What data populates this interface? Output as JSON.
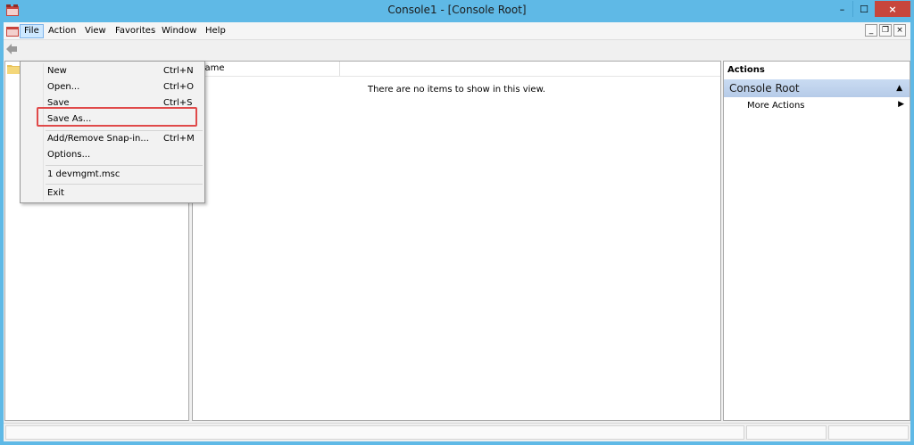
{
  "window": {
    "title": "Console1 - [Console Root]",
    "close_glyph": "×",
    "min_glyph": "–",
    "max_glyph": "☐"
  },
  "menubar": {
    "items": [
      {
        "label": "File"
      },
      {
        "label": "Action"
      },
      {
        "label": "View"
      },
      {
        "label": "Favorites"
      },
      {
        "label": "Window"
      },
      {
        "label": "Help"
      }
    ],
    "mdi_min": "_",
    "mdi_restore": "❐",
    "mdi_close": "×"
  },
  "file_menu": {
    "items": [
      {
        "label": "New",
        "shortcut": "Ctrl+N"
      },
      {
        "label": "Open...",
        "shortcut": "Ctrl+O"
      },
      {
        "label": "Save",
        "shortcut": "Ctrl+S"
      },
      {
        "label": "Save As...",
        "shortcut": ""
      },
      {
        "label": "Add/Remove Snap-in...",
        "shortcut": "Ctrl+M"
      },
      {
        "label": "Options...",
        "shortcut": ""
      },
      {
        "label": "1 devmgmt.msc",
        "shortcut": ""
      },
      {
        "label": "Exit",
        "shortcut": ""
      }
    ]
  },
  "list": {
    "column_name": "Name",
    "empty_message": "There are no items to show in this view."
  },
  "actions": {
    "title": "Actions",
    "section": "Console Root",
    "collapse_glyph": "▲",
    "more_actions": "More Actions",
    "more_arrow": "▶"
  },
  "colors": {
    "titlebar": "#5fb9e6",
    "close_button": "#c7463c",
    "highlight_border": "#e04a4a",
    "actions_header": "#c9dbf2"
  },
  "icons": {
    "app": "mmc-console-icon",
    "back": "back-arrow-icon",
    "folder": "folder-icon"
  }
}
